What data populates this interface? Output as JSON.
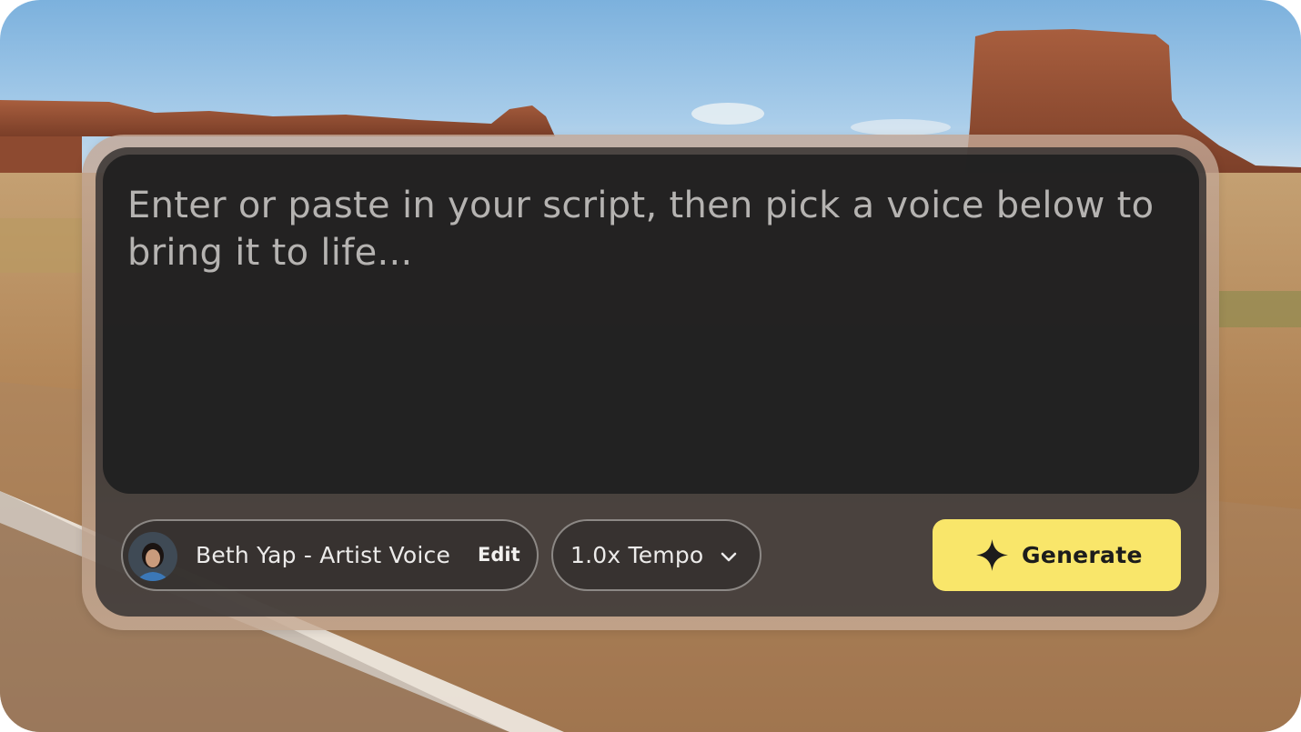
{
  "script_input": {
    "placeholder": "Enter or paste in your script, then pick a voice below to bring it to life..."
  },
  "voice": {
    "name": "Beth Yap - Artist Voice",
    "edit_label": "Edit"
  },
  "tempo": {
    "label": "1.0x Tempo"
  },
  "generate": {
    "label": "Generate"
  },
  "icons": {
    "voice_avatar": "avatar-portrait",
    "tempo_dropdown": "chevron-down-icon",
    "generate": "sparkle-icon"
  },
  "colors": {
    "generate_button": "#f9e66a",
    "panel_dark": "#20201f",
    "placeholder_text": "#b5b3b1"
  }
}
